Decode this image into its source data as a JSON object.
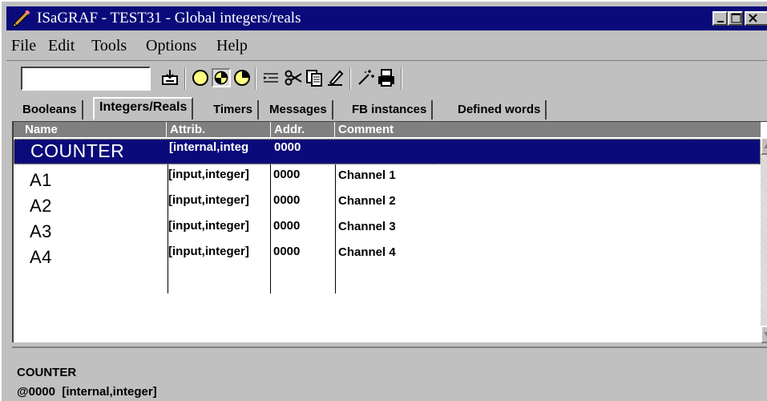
{
  "window": {
    "title": "ISaGRAF - TEST31 - Global integers/reals"
  },
  "menu": [
    {
      "label": "File"
    },
    {
      "label": "Edit"
    },
    {
      "label": "Tools"
    },
    {
      "label": "Options"
    },
    {
      "label": "Help"
    }
  ],
  "toolbar": {
    "search_value": "",
    "tools": [
      "import-icon",
      "circle-empty-icon",
      "circle-half-icon",
      "circle-quarter-icon",
      "insert-line-icon",
      "scissors-icon",
      "copy-icon",
      "pen-icon",
      "wand-icon",
      "printer-icon"
    ]
  },
  "tabs": [
    {
      "label": "Booleans",
      "active": false
    },
    {
      "label": "Integers/Reals",
      "active": true
    },
    {
      "label": "Timers",
      "active": false
    },
    {
      "label": "Messages",
      "active": false
    },
    {
      "label": "FB instances",
      "active": false
    },
    {
      "label": "Defined words",
      "active": false
    }
  ],
  "table": {
    "columns": [
      "Name",
      "Attrib.",
      "Addr.",
      "Comment"
    ],
    "rows": [
      {
        "name": "COUNTER",
        "attrib": "[internal,integ",
        "addr": "0000",
        "comment": "",
        "selected": true
      },
      {
        "name": "A1",
        "attrib": "[input,integer]",
        "addr": "0000",
        "comment": "Channel 1",
        "selected": false
      },
      {
        "name": "A2",
        "attrib": "[input,integer]",
        "addr": "0000",
        "comment": "Channel 2",
        "selected": false
      },
      {
        "name": "A3",
        "attrib": "[input,integer]",
        "addr": "0000",
        "comment": "Channel 3",
        "selected": false
      },
      {
        "name": "A4",
        "attrib": "[input,integer]",
        "addr": "0000",
        "comment": "Channel 4",
        "selected": false
      }
    ]
  },
  "status": {
    "line1": "COUNTER",
    "line2": "@0000  [internal,integer]"
  },
  "colors": {
    "titlebar": "#0a0a7a",
    "selection": "#0a0a7a",
    "header": "#808080",
    "face": "#c0c0c0"
  }
}
